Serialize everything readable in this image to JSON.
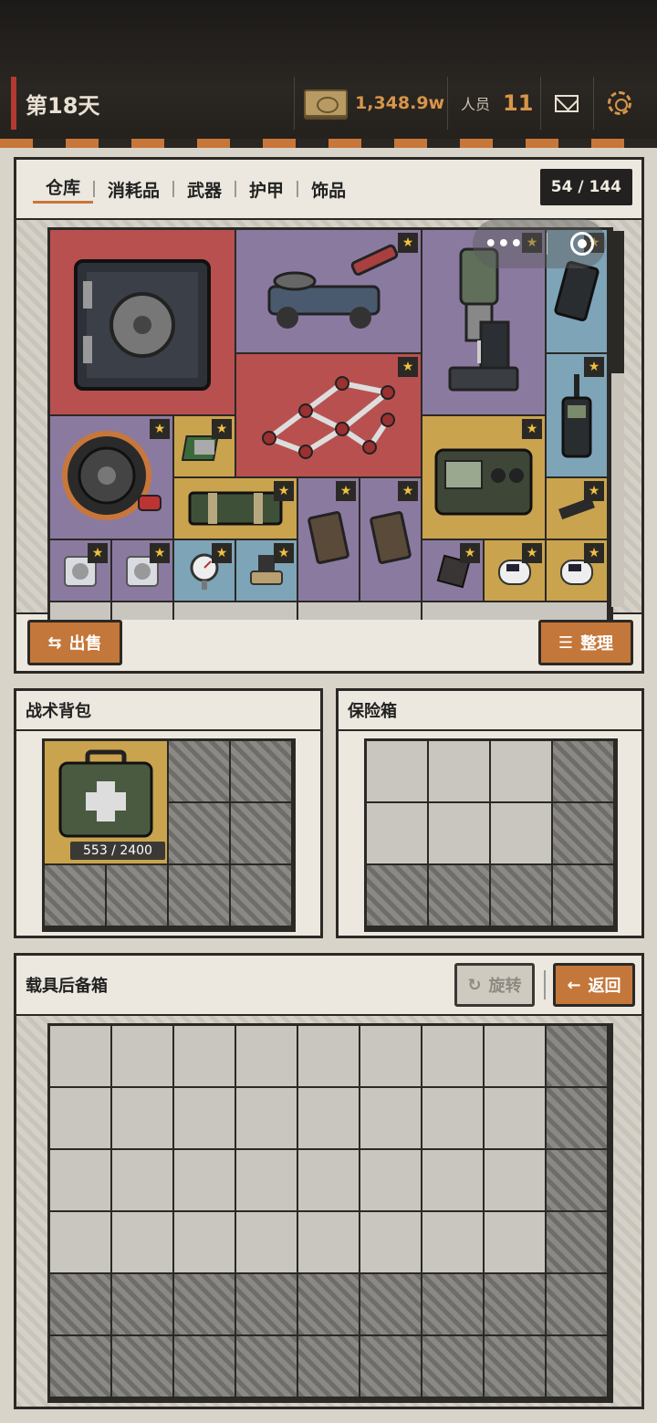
{
  "header": {
    "day": "第18天",
    "money": "1,348.9w",
    "staff_label": "人员",
    "staff_count": "11"
  },
  "warehouse": {
    "tabs": [
      "仓库",
      "消耗品",
      "武器",
      "护甲",
      "饰品"
    ],
    "capacity": "54 / 144",
    "sell_label": "出售",
    "sort_label": "整理"
  },
  "backpack": {
    "title": "战术背包",
    "item_count": "553 / 2400"
  },
  "safebox": {
    "title": "保险箱"
  },
  "trunk": {
    "title": "载具后备箱",
    "rotate_label": "旋转",
    "back_label": "返回"
  },
  "colors": {
    "red": "#b85050",
    "purple": "#8b7aa0",
    "blue": "#7ea4b8",
    "gold": "#c9a34e",
    "accent": "#c4773a"
  },
  "items": [
    {
      "icon": "safe-box-icon",
      "color": "red"
    },
    {
      "icon": "floor-jack-icon",
      "color": "purple",
      "starred": true
    },
    {
      "icon": "drill-press-icon",
      "color": "purple",
      "starred": true
    },
    {
      "icon": "tablet-icon",
      "color": "blue",
      "starred": true
    },
    {
      "icon": "metal-frame-icon",
      "color": "red",
      "starred": true
    },
    {
      "icon": "walkie-talkie-icon",
      "color": "blue",
      "starred": true
    },
    {
      "icon": "cable-reel-icon",
      "color": "purple",
      "starred": true
    },
    {
      "icon": "cpu-chip-icon",
      "color": "gold",
      "starred": true
    },
    {
      "icon": "electronics-case-icon",
      "color": "gold",
      "starred": true
    },
    {
      "icon": "ammo-crate-icon",
      "color": "gold",
      "starred": true
    },
    {
      "icon": "notebook-icon",
      "color": "purple",
      "starred": true
    },
    {
      "icon": "notebook-icon",
      "color": "purple",
      "starred": true
    },
    {
      "icon": "ssd-icon",
      "color": "gold",
      "starred": true
    },
    {
      "icon": "bearing-box-icon",
      "color": "purple",
      "starred": true
    },
    {
      "icon": "bearing-box-icon",
      "color": "purple",
      "starred": true
    },
    {
      "icon": "pressure-gauge-icon",
      "color": "blue",
      "starred": true
    },
    {
      "icon": "valve-icon",
      "color": "blue",
      "starred": true
    },
    {
      "icon": "pouch-icon",
      "color": "purple",
      "starred": true
    },
    {
      "icon": "pulse-oximeter-icon",
      "color": "gold",
      "starred": true
    },
    {
      "icon": "pulse-oximeter-icon",
      "color": "gold",
      "starred": true
    },
    {
      "icon": "medkit-icon",
      "color": "gold"
    }
  ]
}
